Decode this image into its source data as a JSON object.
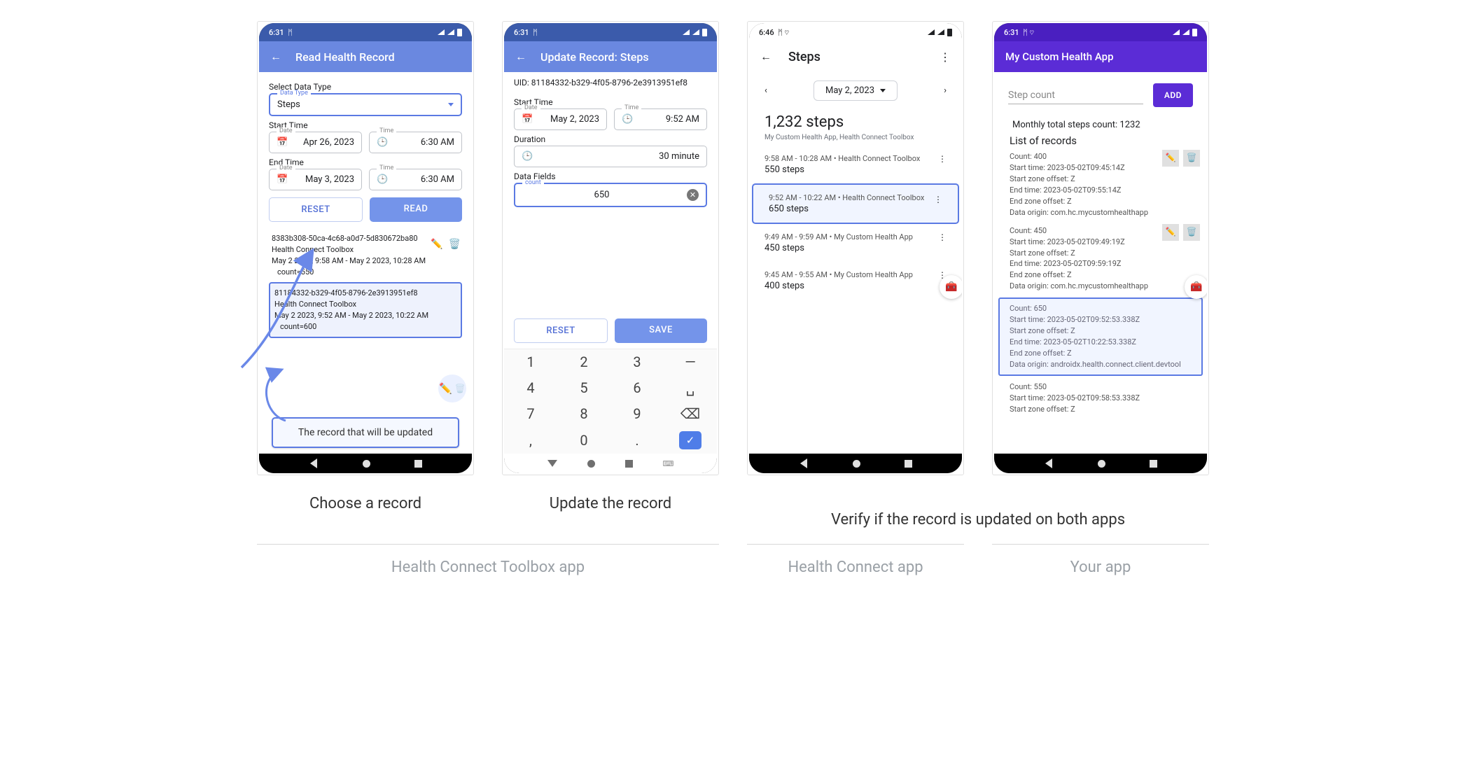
{
  "status_time": {
    "a": "6:31",
    "b": "6:31",
    "c": "6:46",
    "d": "6:31"
  },
  "screen1": {
    "title": "Read Health Record",
    "select_label": "Select Data Type",
    "data_type_legend": "Data Type",
    "data_type_value": "Steps",
    "start_label": "Start Time",
    "end_label": "End Time",
    "date_legend": "Date",
    "time_legend": "Time",
    "start_date": "Apr 26, 2023",
    "start_time_v": "6:30 AM",
    "end_date": "May 3, 2023",
    "end_time_v": "6:30 AM",
    "reset": "RESET",
    "read": "READ",
    "rec1": {
      "id": "8383b308-50ca-4c68-a0d7-5d830672ba80",
      "src": "Health Connect Toolbox",
      "range": "May 2 2023, 9:58 AM - May 2 2023, 10:28 AM",
      "count": "count=550"
    },
    "rec2": {
      "id": "81184332-b329-4f05-8796-2e3913951ef8",
      "src": "Health Connect Toolbox",
      "range": "May 2 2023, 9:52 AM - May 2 2023, 10:22 AM",
      "count": "count=600"
    },
    "tooltip": "The record that will be updated"
  },
  "screen2": {
    "title": "Update Record: Steps",
    "uid_label": "UID: 81184332-b329-4f05-8796-2e3913951ef8",
    "start_label": "Start Time",
    "date_legend": "Date",
    "time_legend": "Time",
    "date": "May 2, 2023",
    "time": "9:52 AM",
    "dur_label": "Duration",
    "dur_value": "30 minute",
    "fields_label": "Data Fields",
    "count_legend": "count",
    "count_value": "650",
    "reset": "RESET",
    "save": "SAVE",
    "keys": [
      "1",
      "2",
      "3",
      "—",
      "4",
      "5",
      "6",
      "␣",
      "7",
      "8",
      "9",
      "⌫",
      ",",
      "0",
      ".",
      "✓"
    ]
  },
  "screen3": {
    "title": "Steps",
    "date": "May 2, 2023",
    "sum": "1,232 steps",
    "sub": "My Custom Health App, Health Connect Toolbox",
    "rows": [
      {
        "t": "9:58 AM - 10:28 AM • Health Connect Toolbox",
        "c": "550 steps"
      },
      {
        "t": "9:52 AM - 10:22 AM • Health Connect Toolbox",
        "c": "650 steps"
      },
      {
        "t": "9:49 AM - 9:59 AM • My Custom Health App",
        "c": "450 steps"
      },
      {
        "t": "9:45 AM - 9:55 AM • My Custom Health App",
        "c": "400 steps"
      }
    ]
  },
  "screen4": {
    "title": "My Custom Health App",
    "placeholder": "Step count",
    "add": "ADD",
    "total": "Monthly total steps count: 1232",
    "list_heading": "List of records",
    "recs": [
      {
        "count": "Count: 400",
        "st": "Start time: 2023-05-02T09:45:14Z",
        "szo": "Start zone offset: Z",
        "et": "End time: 2023-05-02T09:55:14Z",
        "ezo": "End zone offset: Z",
        "or": "Data origin: com.hc.mycustomhealthapp"
      },
      {
        "count": "Count: 450",
        "st": "Start time: 2023-05-02T09:49:19Z",
        "szo": "Start zone offset: Z",
        "et": "End time: 2023-05-02T09:59:19Z",
        "ezo": "End zone offset: Z",
        "or": "Data origin: com.hc.mycustomhealthapp"
      },
      {
        "count": "Count: 650",
        "st": "Start time: 2023-05-02T09:52:53.338Z",
        "szo": "Start zone offset: Z",
        "et": "End time: 2023-05-02T10:22:53.338Z",
        "ezo": "End zone offset: Z",
        "or": "Data origin: androidx.health.connect.client.devtool"
      },
      {
        "count": "Count: 550",
        "st": "Start time: 2023-05-02T09:58:53.338Z",
        "szo": "Start zone offset: Z"
      }
    ]
  },
  "captions": {
    "c1": "Choose a record",
    "c2": "Update the record",
    "c3": "Verify if the record is updated on both apps",
    "sub1": "Health Connect Toolbox  app",
    "sub2": "Health Connect app",
    "sub3": "Your app"
  }
}
